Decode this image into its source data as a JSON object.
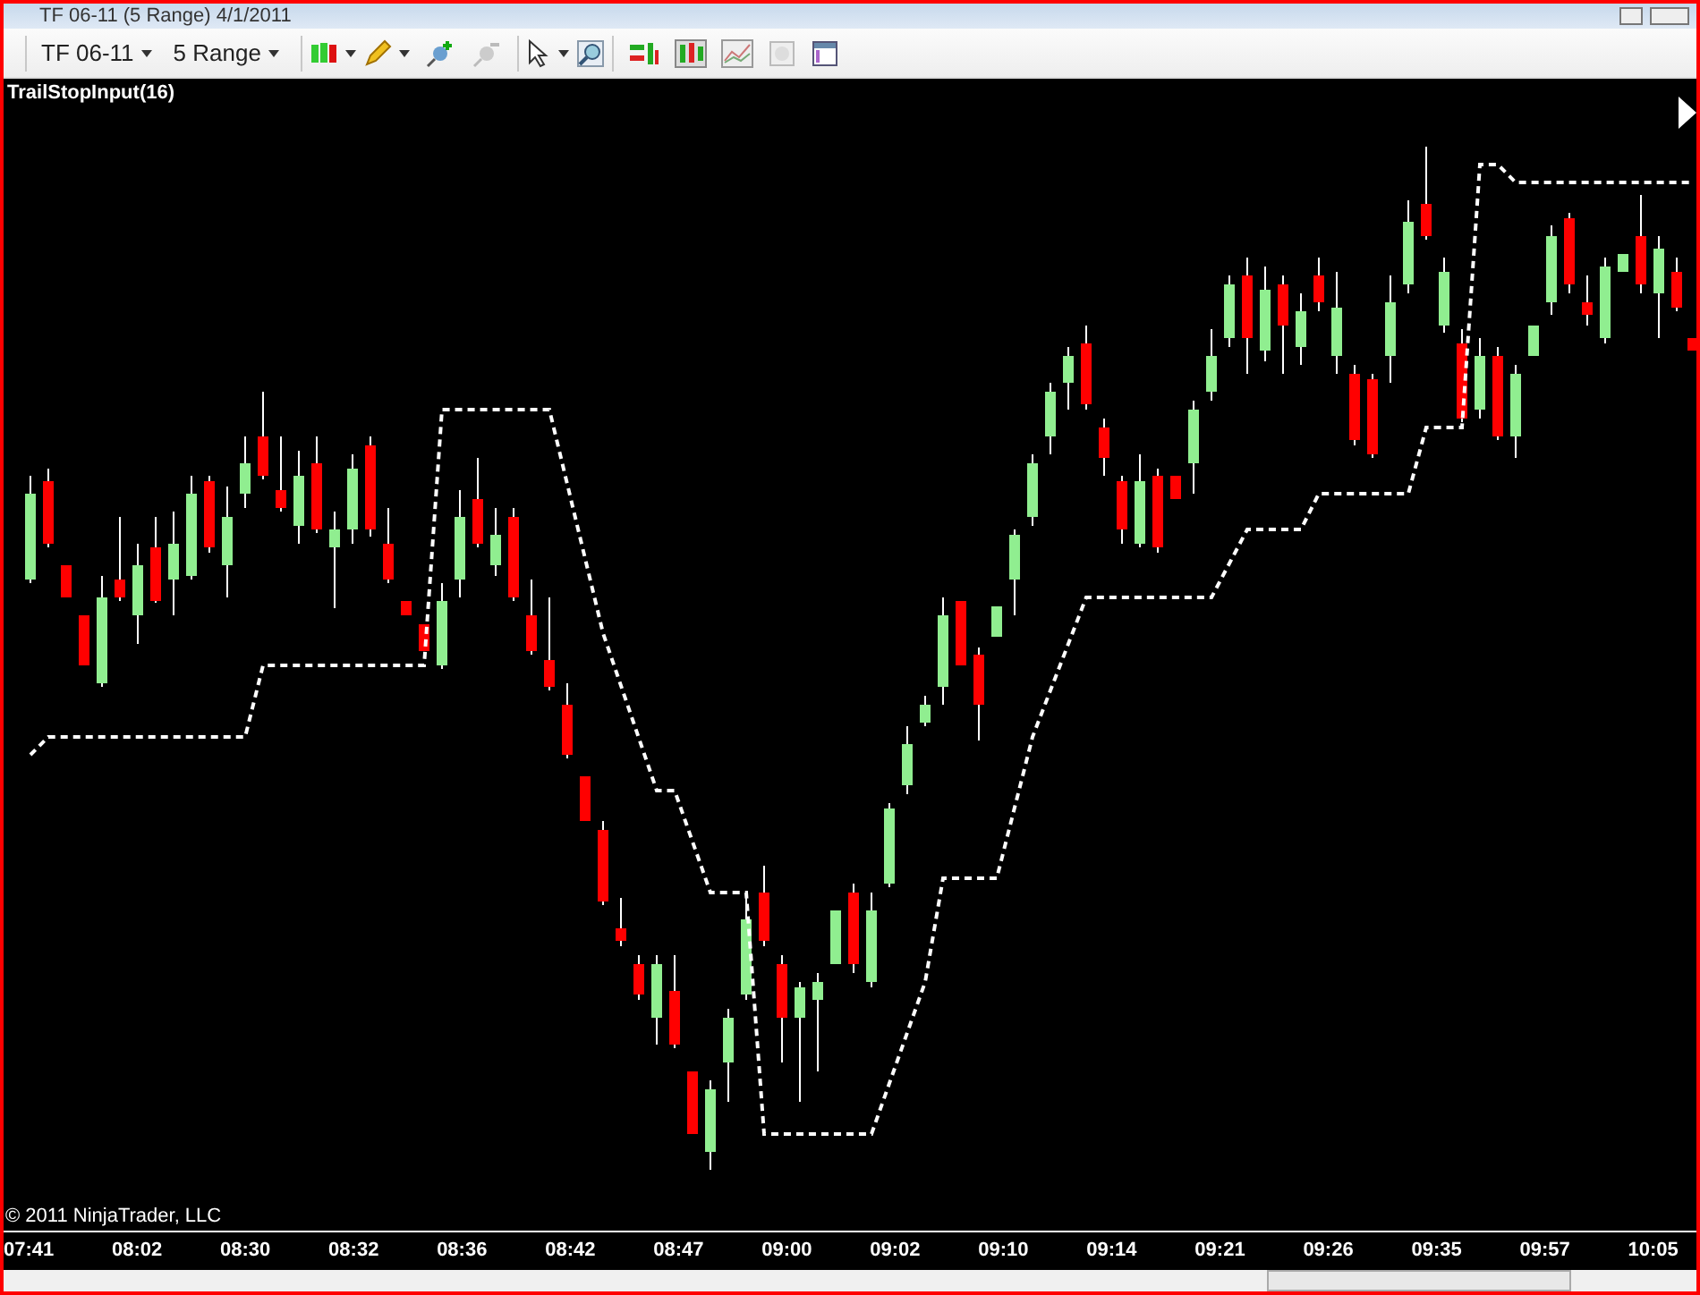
{
  "window": {
    "title": "TF 06-11 (5 Range)  4/1/2011"
  },
  "toolbar": {
    "instrument": "TF 06-11",
    "period": "5 Range"
  },
  "chart": {
    "indicator_label": "TrailStopInput(16)",
    "copyright": "© 2011 NinjaTrader, LLC",
    "x_axis_labels": [
      "07:41",
      "08:02",
      "08:30",
      "08:32",
      "08:36",
      "08:42",
      "08:47",
      "09:00",
      "09:02",
      "09:10",
      "09:14",
      "09:21",
      "09:26",
      "09:35",
      "09:57",
      "10:05"
    ]
  }
}
